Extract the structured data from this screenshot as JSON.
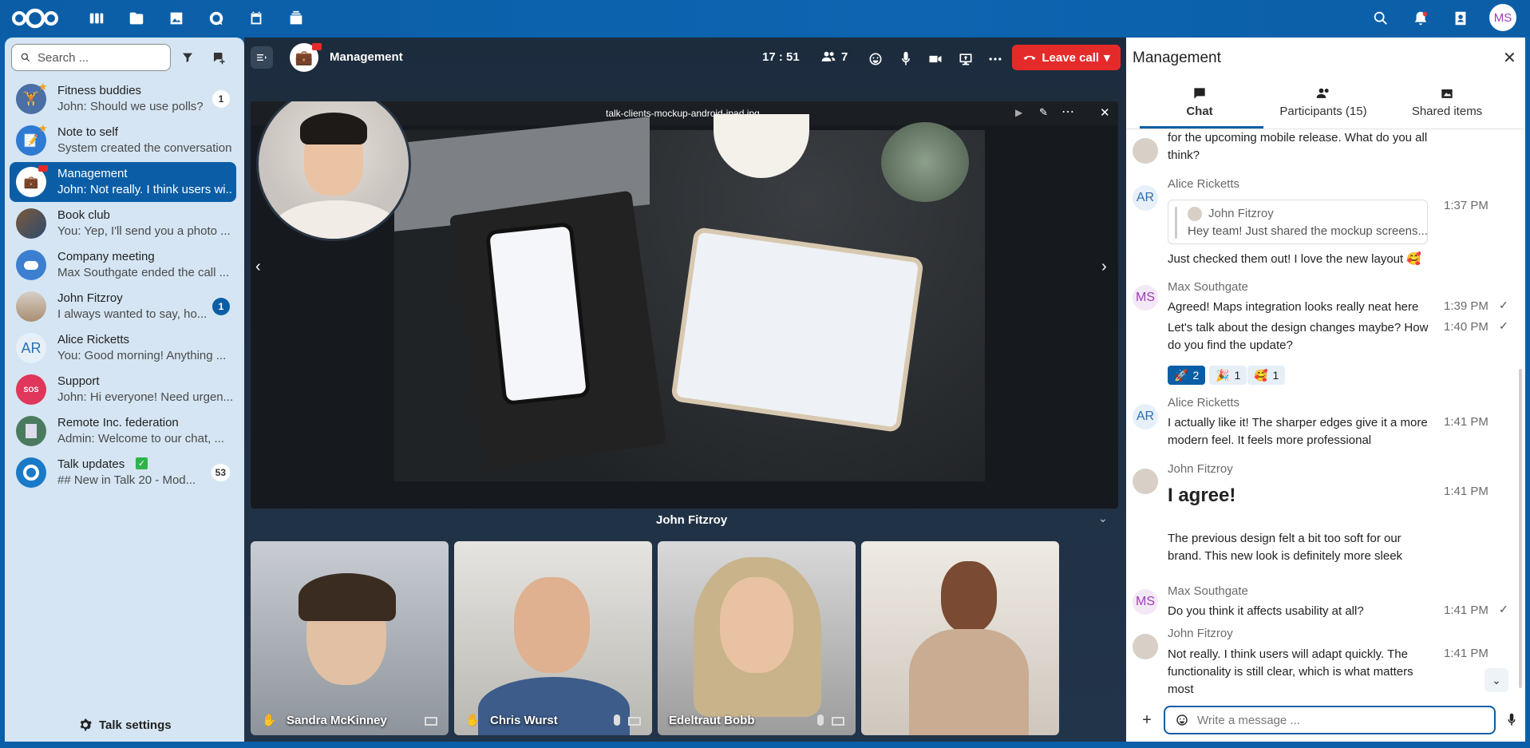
{
  "topbar": {
    "apps": [
      "dashboard-icon",
      "files-icon",
      "photos-icon",
      "talk-icon",
      "calendar-icon",
      "deck-icon"
    ],
    "user_initials": "MS"
  },
  "sidebar": {
    "search_placeholder": "Search ...",
    "conversations": [
      {
        "name": "Fitness buddies",
        "preview": "John: Should we use polls?",
        "badge": "1"
      },
      {
        "name": "Note to self",
        "preview": "System created the conversation",
        "badge": ""
      },
      {
        "name": "Management",
        "preview": "John: Not really. I think users wi...",
        "badge": ""
      },
      {
        "name": "Book club",
        "preview": "You: Yep, I'll send you a photo ...",
        "badge": ""
      },
      {
        "name": "Company meeting",
        "preview": "Max Southgate ended the call ...",
        "badge": ""
      },
      {
        "name": "John Fitzroy",
        "preview": "I always wanted to say, ho...",
        "badge": "1"
      },
      {
        "name": "Alice Ricketts",
        "preview": "You: Good morning! Anything ...",
        "badge": "",
        "initials": "AR"
      },
      {
        "name": "Support",
        "preview": "John: Hi everyone! Need urgen...",
        "badge": "",
        "initials": "SOS"
      },
      {
        "name": "Remote Inc. federation",
        "preview": "Admin: Welcome to our chat, ...",
        "badge": ""
      },
      {
        "name": "Talk updates",
        "preview": "## New in Talk 20 - Mod...",
        "badge": "53"
      }
    ],
    "settings_label": "Talk settings"
  },
  "call": {
    "title": "Management",
    "timer": "17 : 51",
    "participants": "7",
    "leave_label": "Leave call",
    "screen_filename": "talk-clients-mockup-android-ipad.jpg",
    "presenter_name": "John Fitzroy",
    "tiles": [
      {
        "name": "Sandra McKinney"
      },
      {
        "name": "Chris Wurst"
      },
      {
        "name": "Edeltraut Bobb"
      },
      {
        "name": ""
      }
    ]
  },
  "panel": {
    "title": "Management",
    "tabs": [
      "Chat",
      "Participants (15)",
      "Shared items"
    ],
    "messages": [
      {
        "author": "",
        "text": "for the upcoming mobile release. What do you all think?",
        "time": ""
      },
      {
        "author": "Alice Ricketts",
        "initials": "AR",
        "quote_author": "John Fitzroy",
        "quote_text": "Hey team! Just shared the mockup screens...",
        "text": "Just checked them out! I love the new layout 🥰",
        "time": "1:37 PM"
      },
      {
        "author": "Max Southgate",
        "initials": "MS",
        "text": "Agreed! Maps integration looks really neat here",
        "time": "1:39 PM"
      },
      {
        "author": "",
        "text": "Let's talk about the design changes maybe? How do you find the update?",
        "time": "1:40 PM"
      },
      {
        "author": "Alice Ricketts",
        "initials": "AR",
        "text": "I actually like it! The sharper edges give it a more modern feel. It feels more professional",
        "time": "1:41 PM"
      },
      {
        "author": "John Fitzroy",
        "text": "I agree!",
        "time": "1:41 PM"
      },
      {
        "author": "",
        "text": "The previous design felt a bit too soft for our brand. This new look is definitely more sleek",
        "time": ""
      },
      {
        "author": "Max Southgate",
        "initials": "MS",
        "text": "Do you think it affects usability at all?",
        "time": "1:41 PM"
      },
      {
        "author": "John Fitzroy",
        "text": "Not really. I think users will adapt quickly. The functionality is still clear, which is what matters most",
        "time": "1:41 PM"
      }
    ],
    "reactions": [
      {
        "emoji": "🚀",
        "count": "2"
      },
      {
        "emoji": "🎉",
        "count": "1"
      },
      {
        "emoji": "🥰",
        "count": "1"
      }
    ],
    "composer_placeholder": "Write a message ..."
  }
}
